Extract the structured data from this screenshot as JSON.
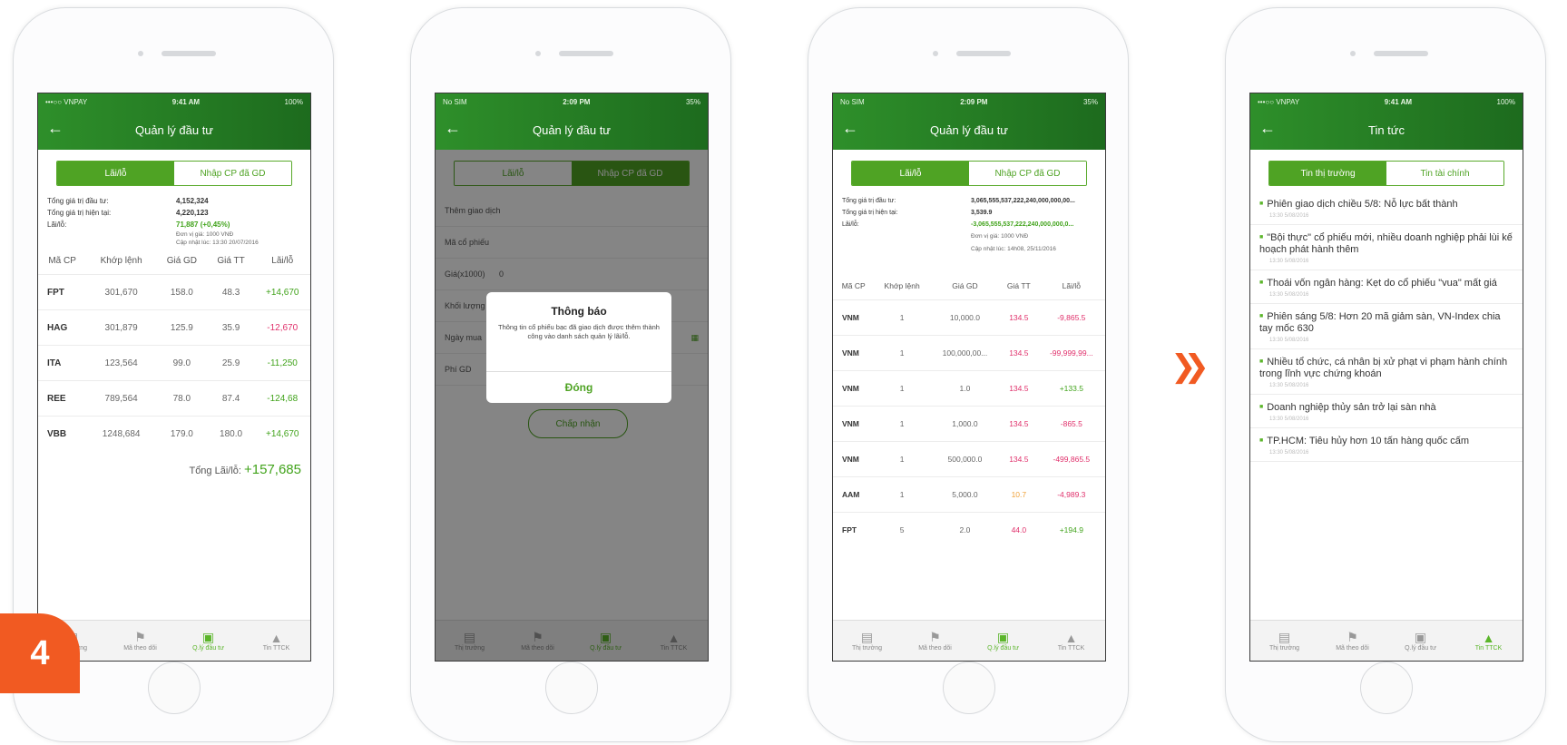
{
  "status": {
    "carrier1": "•••○○ VNPAY",
    "time1": "9:41 AM",
    "battery1": "100%",
    "carrier2": "No SIM",
    "time2": "2:09 PM",
    "battery2": "35%"
  },
  "screen1": {
    "title": "Quản lý đầu tư",
    "seg": [
      "Lãi/lỗ",
      "Nhập CP đã GD"
    ],
    "summary": [
      {
        "k": "Tổng giá trị đầu tư:",
        "v": "4,152,324"
      },
      {
        "k": "Tổng giá trị hiện tại:",
        "v": "4,220,123"
      },
      {
        "k": "Lãi/lỗ:",
        "v": "71,887 (+0,45%)"
      }
    ],
    "note1": "Đơn vị giá: 1000 VNĐ",
    "note2": "Cập nhật lúc: 13:30 20/07/2016",
    "headers": [
      "Mã CP",
      "Khớp lệnh",
      "Giá GD",
      "Giá TT",
      "Lãi/lỗ"
    ],
    "rows": [
      [
        "FPT",
        "301,670",
        "158.0",
        "48.3",
        "+14,670"
      ],
      [
        "HAG",
        "301,879",
        "125.9",
        "35.9",
        "-12,670"
      ],
      [
        "ITA",
        "123,564",
        "99.0",
        "25.9",
        "-11,250"
      ],
      [
        "REE",
        "789,564",
        "78.0",
        "87.4",
        "-124,68"
      ],
      [
        "VBB",
        "1248,684",
        "179.0",
        "180.0",
        "+14,670"
      ]
    ],
    "total_label": "Tổng Lãi/lỗ:",
    "total_value": "+157,685"
  },
  "screen2": {
    "title": "Quản lý đầu tư",
    "seg": [
      "Lãi/lỗ",
      "Nhập CP đã GD"
    ],
    "fields": [
      {
        "label": "Thêm giao dịch",
        "value": ""
      },
      {
        "label": "Mã cổ phiếu",
        "value": ""
      },
      {
        "label": "Giá(x1000)",
        "value": "0"
      },
      {
        "label": "Khối lượng",
        "value": "1"
      },
      {
        "label": "Ngày mua",
        "value": ""
      },
      {
        "label": "Phí GD",
        "value": ""
      }
    ],
    "dialog_title": "Thông báo",
    "dialog_text": "Thông tin cổ phiếu bạc đã giao dịch được thêm thành công vào danh sách quản lý lãi/lỗ.",
    "dialog_btn": "Đóng",
    "confirm": "Chấp nhận"
  },
  "screen3": {
    "title": "Quản lý đầu tư",
    "seg": [
      "Lãi/lỗ",
      "Nhập CP đã GD"
    ],
    "summary": [
      {
        "k": "Tổng giá trị đầu tư:",
        "v": "3,065,555,537,222,240,000,000,00..."
      },
      {
        "k": "Tổng giá trị hiện tại:",
        "v": "3,539.9"
      },
      {
        "k": "Lãi/lỗ:",
        "v": "-3,065,555,537,222,240,000,000,0..."
      }
    ],
    "note1": "Đơn vị giá: 1000 VNĐ",
    "note2": "Cập nhật lúc: 14h08, 25/11/2016",
    "headers": [
      "Mã CP",
      "Khớp lệnh",
      "Giá GD",
      "Giá TT",
      "Lãi/lỗ"
    ],
    "rows": [
      [
        "VNM",
        "1",
        "10,000.0",
        "134.5",
        "-9,865.5"
      ],
      [
        "VNM",
        "1",
        "100,000,00...",
        "134.5",
        "-99,999,99..."
      ],
      [
        "VNM",
        "1",
        "1.0",
        "134.5",
        "+133.5"
      ],
      [
        "VNM",
        "1",
        "1,000.0",
        "134.5",
        "-865.5"
      ],
      [
        "VNM",
        "1",
        "500,000.0",
        "134.5",
        "-499,865.5"
      ],
      [
        "AAM",
        "1",
        "5,000.0",
        "10.7",
        "-4,989.3"
      ],
      [
        "FPT",
        "5",
        "2.0",
        "44.0",
        "+194.9"
      ]
    ]
  },
  "screen4": {
    "title": "Tin tức",
    "seg": [
      "Tin thị trường",
      "Tin tài chính"
    ],
    "news": [
      {
        "t": "Phiên giao dịch chiều 5/8: Nỗ lực bất thành",
        "d": "13:30 5/08/2016"
      },
      {
        "t": "\"Bội thực\" cổ phiếu mới, nhiều doanh nghiệp phải lùi kế hoạch phát hành thêm",
        "d": "13:30 5/08/2016"
      },
      {
        "t": "Thoái vốn ngân hàng: Kẹt do cổ phiếu \"vua\" mất giá",
        "d": "13:30 5/08/2016"
      },
      {
        "t": "Phiên sáng 5/8: Hơn 20 mã giảm sàn, VN-Index chia tay mốc 630",
        "d": "13:30 5/08/2016"
      },
      {
        "t": "Nhiều tổ chức, cá nhân bị xử phạt vi phạm hành chính trong lĩnh vực chứng khoán",
        "d": "13:30 5/08/2016"
      },
      {
        "t": "Doanh nghiệp thủy sản trở lại sàn nhà",
        "d": "13:30 5/08/2016"
      },
      {
        "t": "TP.HCM: Tiêu hủy hơn 10 tấn hàng quốc cấm",
        "d": "13:30 5/08/2016"
      }
    ]
  },
  "tabbar": [
    "Thị trường",
    "Mã theo dõi",
    "Q.lý đầu tư",
    "Tin TTCK"
  ],
  "tabbar_icons": [
    "chart-icon",
    "flag-icon",
    "briefcase-icon",
    "news-icon"
  ],
  "step_badge": "4",
  "colors": {
    "brand_green": "#2e8f2a",
    "accent_green": "#4fa324",
    "loss_red": "#e0306b",
    "badge_orange": "#f15a22"
  }
}
